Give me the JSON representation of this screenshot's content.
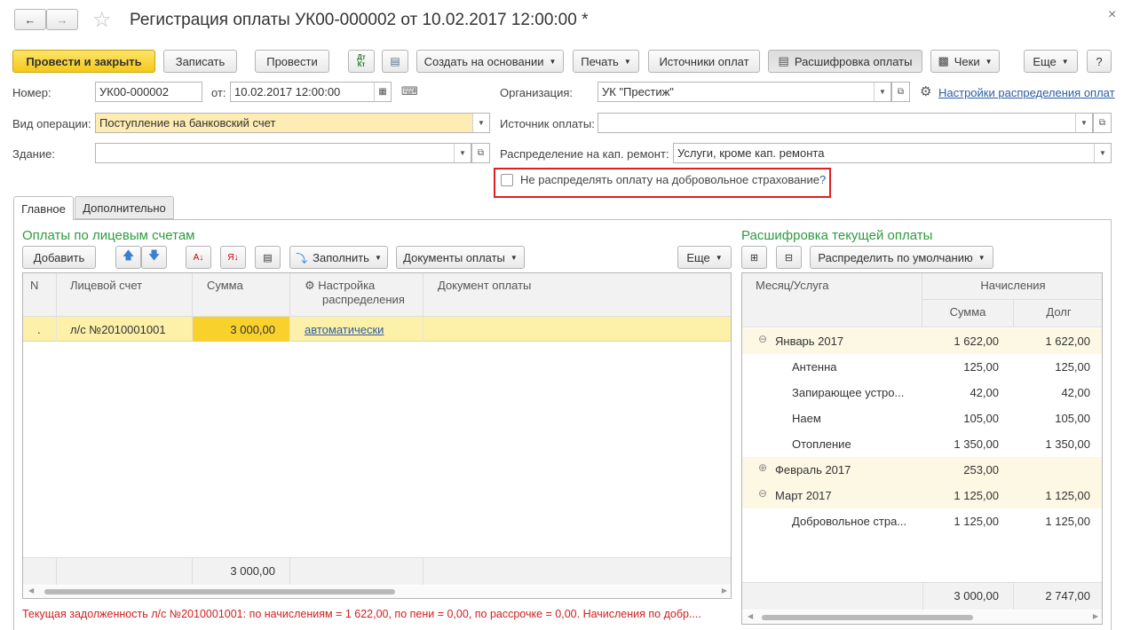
{
  "window": {
    "title": "Регистрация оплаты УК00-000002 от 10.02.2017 12:00:00 *",
    "close": "×"
  },
  "toolbar": {
    "post_close": "Провести и закрыть",
    "save": "Записать",
    "post": "Провести",
    "dtkt": "Дт Кт",
    "create_based": "Создать на основании",
    "print": "Печать",
    "sources": "Источники оплат",
    "breakdown": "Расшифровка оплаты",
    "receipts": "Чеки",
    "more": "Еще",
    "help": "?"
  },
  "header": {
    "number_label": "Номер:",
    "number_value": "УК00-000002",
    "date_label": "от:",
    "date_value": "10.02.2017 12:00:00",
    "org_label": "Организация:",
    "org_value": "УК \"Престиж\"",
    "settings_link": "Настройки распределения оплат",
    "op_label": "Вид операции:",
    "op_value": "Поступление на банковский счет",
    "source_label": "Источник оплаты:",
    "source_value": "",
    "building_label": "Здание:",
    "building_value": "",
    "capital_label": "Распределение на кап. ремонт:",
    "capital_value": "Услуги, кроме кап. ремонта",
    "insurance_checkbox": "Не распределять оплату на добровольное страхование",
    "insurance_help": "?"
  },
  "tabs": [
    {
      "label": "Главное",
      "active": true
    },
    {
      "label": "Дополнительно",
      "active": false
    }
  ],
  "left": {
    "title": "Оплаты по лицевым счетам",
    "add": "Добавить",
    "fill": "Заполнить",
    "docs": "Документы оплаты",
    "more": "Еще",
    "columns": [
      "N",
      "Лицевой счет",
      "Сумма",
      "Настройка",
      "распределения",
      "Документ оплаты"
    ],
    "rows": [
      {
        "n": ".",
        "account": "л/с №2010001001",
        "sum": "3 000,00",
        "setting": "автоматически",
        "doc": ""
      }
    ],
    "total_sum": "3 000,00"
  },
  "right": {
    "title": "Расшифровка текущей оплаты",
    "distribute": "Распределить по умолчанию",
    "col_month": "Месяц/Услуга",
    "col_accruals": "Начисления",
    "col_sum": "Сумма",
    "col_debt": "Долг",
    "rows": [
      {
        "name": "Январь 2017",
        "sum": "1 622,00",
        "debt": "1 622,00",
        "level": 0,
        "toggle": "⊖",
        "group": true
      },
      {
        "name": "Антенна",
        "sum": "125,00",
        "debt": "125,00",
        "level": 1,
        "toggle": "",
        "group": false
      },
      {
        "name": "Запирающее устро...",
        "sum": "42,00",
        "debt": "42,00",
        "level": 1,
        "toggle": "",
        "group": false
      },
      {
        "name": "Наем",
        "sum": "105,00",
        "debt": "105,00",
        "level": 1,
        "toggle": "",
        "group": false
      },
      {
        "name": "Отопление",
        "sum": "1 350,00",
        "debt": "1 350,00",
        "level": 1,
        "toggle": "",
        "group": false
      },
      {
        "name": "Февраль 2017",
        "sum": "253,00",
        "debt": "",
        "level": 0,
        "toggle": "⊕",
        "group": true
      },
      {
        "name": "Март 2017",
        "sum": "1 125,00",
        "debt": "1 125,00",
        "level": 0,
        "toggle": "⊖",
        "group": true
      },
      {
        "name": "Добровольное стра...",
        "sum": "1 125,00",
        "debt": "1 125,00",
        "level": 1,
        "toggle": "",
        "group": false
      }
    ],
    "total_sum": "3 000,00",
    "total_debt": "2 747,00"
  },
  "status": "Текущая задолженность л/с №2010001001: по начислениям = 1 622,00, по пени = 0,00, по рассрочке = 0,00. Начисления по добр...."
}
